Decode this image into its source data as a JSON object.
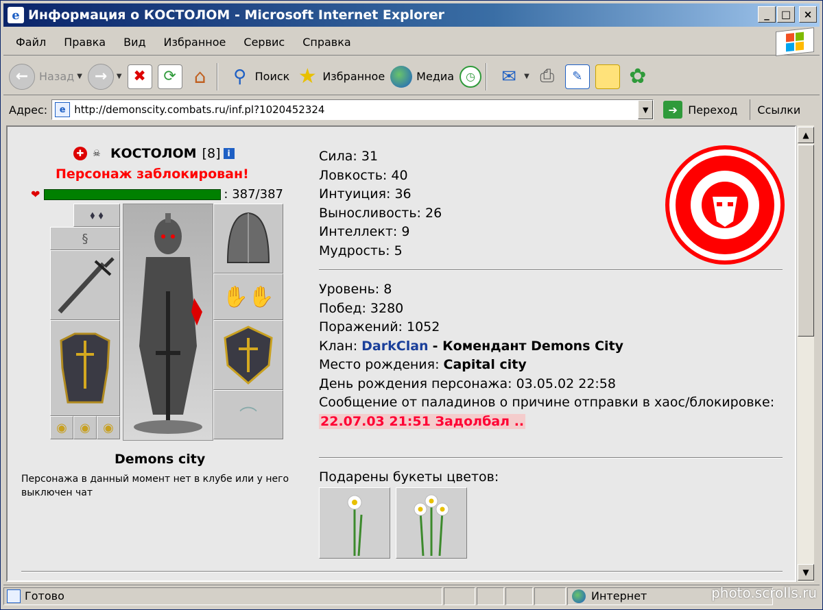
{
  "window": {
    "title": "Информация о КОСТОЛОМ - Microsoft Internet Explorer",
    "minimize": "_",
    "maximize": "□",
    "close": "×"
  },
  "menu": {
    "items": [
      {
        "label": "Файл"
      },
      {
        "label": "Правка"
      },
      {
        "label": "Вид"
      },
      {
        "label": "Избранное"
      },
      {
        "label": "Сервис"
      },
      {
        "label": "Справка"
      }
    ]
  },
  "toolbar": {
    "back": "Назад",
    "search": "Поиск",
    "favorites": "Избранное",
    "media": "Медиа"
  },
  "address": {
    "label": "Адрес:",
    "url": "http://demonscity.combats.ru/inf.pl?1020452324",
    "go": "Переход",
    "links": "Ссылки"
  },
  "character": {
    "name": "КОСТОЛОМ",
    "level": "[8]",
    "blocked": "Персонаж заблокирован!",
    "hp": "387/387",
    "hp_fraction": 1.0,
    "city": "Demons city",
    "offline_note": "Персонажа в данный момент нет в клубе или у него выключен чат"
  },
  "stats": [
    {
      "label": "Сила:",
      "value": "31"
    },
    {
      "label": "Ловкость:",
      "value": "40"
    },
    {
      "label": "Интуиция:",
      "value": "36"
    },
    {
      "label": "Выносливость:",
      "value": "26"
    },
    {
      "label": "Интеллект:",
      "value": "9"
    },
    {
      "label": "Мудрость:",
      "value": "5"
    }
  ],
  "info": {
    "level_label": "Уровень:",
    "level": "8",
    "wins_label": "Побед:",
    "wins": "3280",
    "losses_label": "Поражений:",
    "losses": "1052",
    "clan_label": "Клан:",
    "clan": "DarkClan",
    "clan_rank": "- Комендант Demons City",
    "birthplace_label": "Место рождения:",
    "birthplace": "Capital city",
    "birthday_label": "День рождения персонажа:",
    "birthday": "03.05.02 22:58",
    "paladin_msg": "Сообщение от паладинов о причине отправки в хаос/блокировке:",
    "reason": "22.07.03 21:51 Задолбал .."
  },
  "flowers": {
    "label": "Подарены букеты цветов:"
  },
  "status": {
    "ready": "Готово",
    "zone": "Интернет"
  },
  "watermark": "photo.scrolls.ru",
  "colors": {
    "blocked": "#ff0000",
    "hp": "#008000",
    "clan_link": "#1a3f9a",
    "reason": "#ff0033",
    "emblem": "#ff0000"
  }
}
